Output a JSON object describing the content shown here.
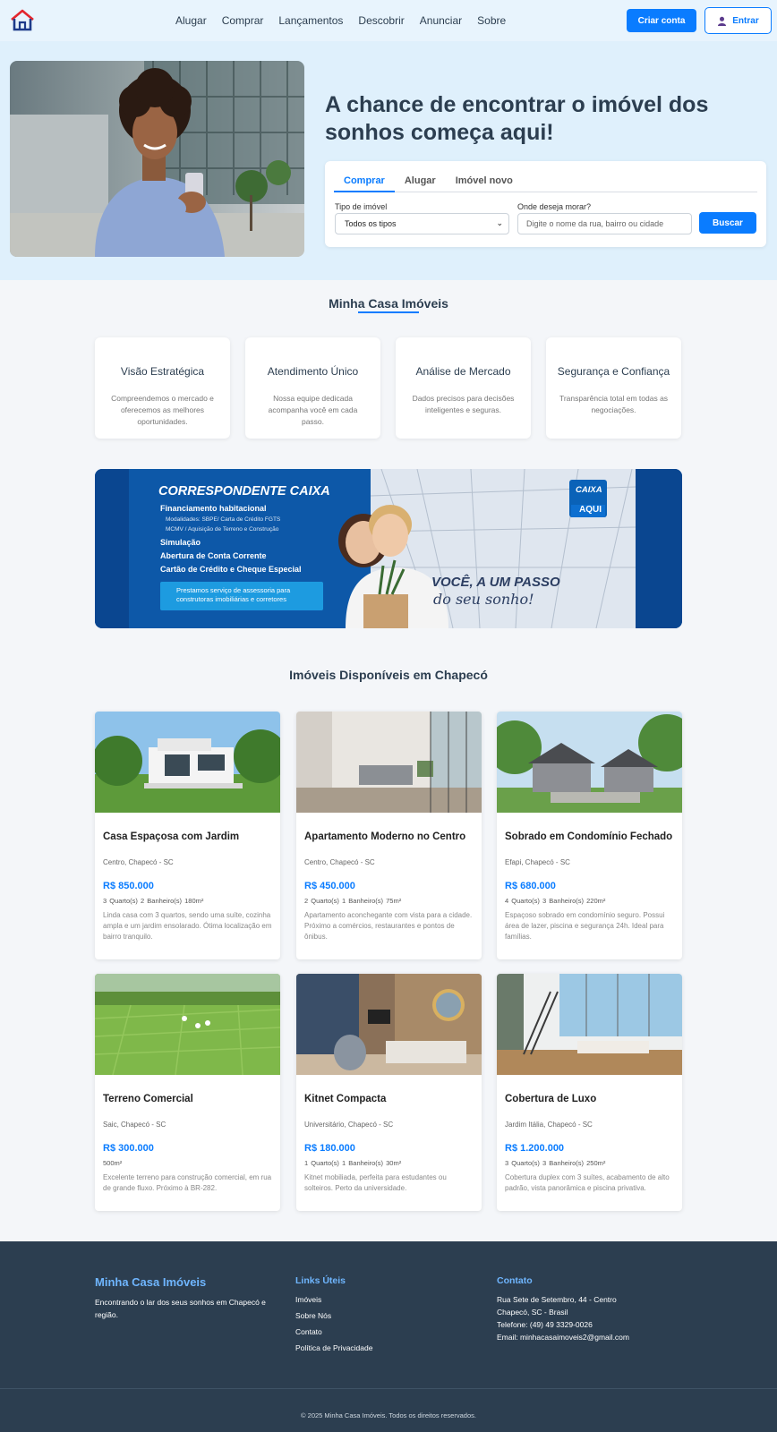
{
  "nav": {
    "logo_icon": "house-logo-icon",
    "links": [
      "Alugar",
      "Comprar",
      "Lançamentos",
      "Descobrir",
      "Anunciar",
      "Sobre"
    ],
    "criar_conta": "Criar conta",
    "entrar": "Entrar"
  },
  "hero": {
    "title": "A chance de encontrar o imóvel dos sonhos começa aqui!",
    "tabs": [
      "Comprar",
      "Alugar",
      "Imóvel novo"
    ],
    "active_tab": "Comprar",
    "tipo_label": "Tipo de imóvel",
    "tipo_value": "Todos os tipos",
    "onde_label": "Onde deseja morar?",
    "onde_placeholder": "Digite o nome da rua, bairro ou cidade",
    "buscar": "Buscar"
  },
  "about": {
    "title": "Minha Casa Imóveis",
    "features": [
      {
        "title": "Visão Estratégica",
        "desc": "Compreendemos o mercado e oferecemos as melhores oportunidades."
      },
      {
        "title": "Atendimento Único",
        "desc": "Nossa equipe dedicada acompanha você em cada passo."
      },
      {
        "title": "Análise de Mercado",
        "desc": "Dados precisos para decisões inteligentes e seguras."
      },
      {
        "title": "Segurança e Confiança",
        "desc": "Transparência total em todas as negociações."
      }
    ]
  },
  "banner": {
    "heading": "CORRESPONDENTE CAIXA",
    "line1": "Financiamento habitacional",
    "sub1": "Modalidades: SBPE/ Carta de Crédito FGTS",
    "sub2": "MCMV / Aquisição de Terreno e Construção",
    "line2": "Simulação",
    "line3": "Abertura de Conta Corrente",
    "line4": "Cartão de Crédito e Cheque Especial",
    "box": "Prestamos serviço de assessoria para construtoras imobiliárias e corretores",
    "slogan1": "VOCÊ, A UM PASSO",
    "slogan2": "do seu sonho!",
    "caixa1": "CAIXA",
    "caixa2": "AQUI"
  },
  "listings": {
    "title": "Imóveis Disponíveis em Chapecó",
    "items": [
      {
        "title": "Casa Espaçosa com Jardim",
        "loc": "Centro, Chapecó - SC",
        "price": "R$ 850.000",
        "meta": "3 Quarto(s)   2 Banheiro(s)   180m²",
        "desc": "Linda casa com 3 quartos, sendo uma suíte, cozinha ampla e um jardim ensolarado. Ótima localização em bairro tranquilo."
      },
      {
        "title": "Apartamento Moderno no Centro",
        "loc": "Centro, Chapecó - SC",
        "price": "R$ 450.000",
        "meta": "2 Quarto(s)   1 Banheiro(s)   75m²",
        "desc": "Apartamento aconchegante com vista para a cidade. Próximo a comércios, restaurantes e pontos de ônibus."
      },
      {
        "title": "Sobrado em Condomínio Fechado",
        "loc": "Efapi, Chapecó - SC",
        "price": "R$ 680.000",
        "meta": "4 Quarto(s)   3 Banheiro(s)   220m²",
        "desc": "Espaçoso sobrado em condomínio seguro. Possui área de lazer, piscina e segurança 24h. Ideal para famílias."
      },
      {
        "title": "Terreno Comercial",
        "loc": "Saic, Chapecó - SC",
        "price": "R$ 300.000",
        "meta": "500m²",
        "desc": "Excelente terreno para construção comercial, em rua de grande fluxo. Próximo à BR-282."
      },
      {
        "title": "Kitnet Compacta",
        "loc": "Universitário, Chapecó - SC",
        "price": "R$ 180.000",
        "meta": "1 Quarto(s)   1 Banheiro(s)   30m²",
        "desc": "Kitnet mobiliada, perfeita para estudantes ou solteiros. Perto da universidade."
      },
      {
        "title": "Cobertura de Luxo",
        "loc": "Jardim Itália, Chapecó - SC",
        "price": "R$ 1.200.000",
        "meta": "3 Quarto(s)   3 Banheiro(s)   250m²",
        "desc": "Cobertura duplex com 3 suítes, acabamento de alto padrão, vista panorâmica e piscina privativa."
      }
    ]
  },
  "footer": {
    "brand": "Minha Casa Imóveis",
    "tagline": "Encontrando o lar dos seus sonhos em Chapecó e região.",
    "links_title": "Links Úteis",
    "links": [
      "Imóveis",
      "Sobre Nós",
      "Contato",
      "Política de Privacidade"
    ],
    "contact_title": "Contato",
    "contact": [
      "Rua Sete de Setembro, 44 - Centro",
      "Chapecó, SC - Brasil",
      "Telefone: (49) 49 3329-0026",
      "Email: minhacasaimoveis2@gmail.com"
    ],
    "copyright": "© 2025 Minha Casa Imóveis. Todos os direitos reservados."
  },
  "colors": {
    "accent": "#0a7cff",
    "dark": "#2c3e50",
    "hero_bg": "#dff0fc",
    "banner_bg": "#0b4fa0"
  }
}
